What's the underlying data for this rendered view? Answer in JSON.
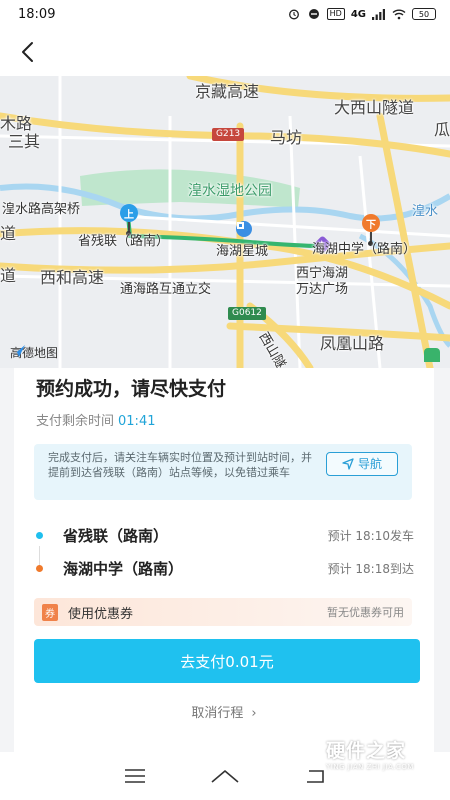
{
  "status_bar": {
    "time": "18:09",
    "network": "4G",
    "battery": "50"
  },
  "header": {
    "back_icon": "chevron-left-icon"
  },
  "map": {
    "labels": {
      "jingzang": "京藏高速",
      "daxishan": "大西山隧道",
      "gua": "瓜",
      "mumu": "木路",
      "sanqi": "三其",
      "mafang": "马坊",
      "g213": "G213",
      "park": "湟水湿地公园",
      "huangshui_bridge": "湟水路高架桥",
      "huangshui_river": "湟水",
      "dao": "道",
      "start_stop": "省残联（路南）",
      "haihu_xingcheng": "海湖星城",
      "end_stop": "海湖中学（路南）",
      "dao2": "道",
      "xihe": "西和高速",
      "xining_wanda_1": "西宁海湖",
      "xining_wanda_2": "万达广场",
      "tonghai": "通海路互通立交",
      "g0612": "G0612",
      "xishan": "西山隧",
      "fenghuang": "凤凰山路",
      "amap": "高德地图"
    },
    "pin_up": "上",
    "pin_down": "下"
  },
  "booking": {
    "title": "预约成功，请尽快支付",
    "timer_label": "支付剩余时间",
    "timer_value": "01:41",
    "notice": "完成支付后，请关注车辆实时位置及预计到站时间，并提前到达省残联（路南）站点等候，以免错过乘车",
    "nav_label": "导航",
    "stops": [
      {
        "name": "省残联（路南）",
        "eta": "预计 18:10发车",
        "color": "#1fbfee"
      },
      {
        "name": "海湖中学（路南）",
        "eta": "预计 18:18到达",
        "color": "#f07a2c"
      }
    ],
    "coupon": {
      "badge": "券",
      "label": "使用优惠券",
      "status": "暂无优惠券可用"
    },
    "pay_label": "去支付0.01元",
    "cancel_label": "取消行程"
  },
  "watermark": {
    "main": "硬件之家",
    "sub": "YING JIAN ZHI JIA.COM"
  },
  "colors": {
    "accent": "#1fc1ef",
    "start": "#1fbfee",
    "end": "#f07a2c"
  }
}
